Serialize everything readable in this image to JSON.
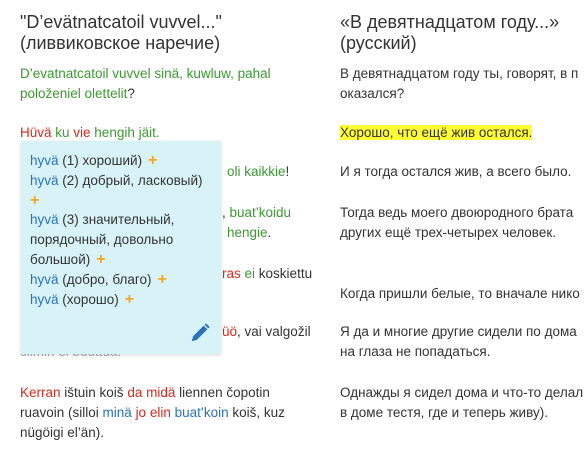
{
  "left_column": {
    "title_line1": "\"D’evätnatcatoil vuvvel...\"",
    "title_line2": "(ливвиковское наречие)",
    "p1": {
      "l1": [
        {
          "t": "D’evatnatcatoil vuvvel sinä, kuwluw, pahal",
          "c": "green"
        }
      ],
      "l2": [
        {
          "t": "položeniel olettelit",
          "c": "green"
        },
        {
          "t": "?",
          "c": "dark"
        }
      ]
    },
    "p2": [
      {
        "t": "Hüvä",
        "c": "red"
      },
      {
        "t": " ku ",
        "c": "green"
      },
      {
        "t": "vie",
        "c": "red"
      },
      {
        "t": " hengih jäit.",
        "c": "green"
      }
    ],
    "p3_tail": [
      {
        "t": "oli kaikkie",
        "c": "green"
      },
      {
        "t": "!",
        "c": "dark"
      }
    ],
    "p4_tail": [
      {
        "t": ", ",
        "c": "dark"
      },
      {
        "t": "buat’koidu",
        "c": "green"
      }
    ],
    "p4_tail2": [
      {
        "t": "hengie",
        "c": "green"
      },
      {
        "t": ".",
        "c": "dark"
      }
    ],
    "p5_tail": [
      {
        "t": "ras",
        "c": "red"
      },
      {
        "t": " ",
        "c": "dark"
      },
      {
        "t": "ei",
        "c": "green"
      },
      {
        "t": " koskiettu",
        "c": "dark"
      }
    ],
    "p6_tail": [
      {
        "t": "üö",
        "c": "red"
      },
      {
        "t": ", vai valgožil",
        "c": "dark"
      }
    ],
    "p6_cut": "silmih ei puuttua.",
    "p7": {
      "l1": [
        {
          "t": "Kerran",
          "c": "red"
        },
        {
          "t": " ištuin koiš ",
          "c": "dark"
        },
        {
          "t": "da midä",
          "c": "red"
        },
        {
          "t": " liennen čopotin",
          "c": "dark"
        }
      ],
      "l2": [
        {
          "t": "ruavoin (silloi ",
          "c": "dark"
        },
        {
          "t": "minä",
          "c": "blue"
        },
        {
          "t": " ",
          "c": "dark"
        },
        {
          "t": "jo elin",
          "c": "red"
        },
        {
          "t": " ",
          "c": "dark"
        },
        {
          "t": "buat’koin",
          "c": "blue"
        },
        {
          "t": " koiš, kuz",
          "c": "dark"
        }
      ],
      "l3": [
        {
          "t": "nügöigi el’än).",
          "c": "dark"
        }
      ]
    }
  },
  "right_column": {
    "title_line1": "«В девятнадцатом году...»",
    "title_line2": "(русский)",
    "p1_l1": "В девятнадцатом году ты, говорят, в п",
    "p1_l2": "оказался?",
    "p2": "Хорошо, что ещё жив остался.",
    "p3": "И я тогда остался жив, а всего было.",
    "p4_l1": "Тогда ведь моего двоюродного брата",
    "p4_l2": "других ещё трех-четырех человек.",
    "p5": "Когда пришли белые, то вначале нико",
    "p6_l1": "Я да и многие другие сидели по дома",
    "p6_l2": "на глаза не попадаться.",
    "p7_l1": "Однажды я сидел дома и что-то делал",
    "p7_l2": "в доме тестя, где и теперь живу)."
  },
  "popup": {
    "entries": [
      {
        "lemma": "hyvä",
        "gloss": " (1) хороший)"
      },
      {
        "lemma": "hyvä",
        "gloss": " (2) добрый, ласковый)"
      },
      {
        "lemma": "hyvä",
        "gloss": " (3) значительный,"
      },
      {
        "lemma": "",
        "gloss": "порядочный, довольно"
      },
      {
        "lemma": "",
        "gloss": "большой)"
      },
      {
        "lemma": "hyvä",
        "gloss": " (добро, благо)"
      },
      {
        "lemma": "hyvä",
        "gloss": " (хорошо)"
      }
    ],
    "plus_symbol": "+",
    "edit_icon": "pencil-icon"
  }
}
